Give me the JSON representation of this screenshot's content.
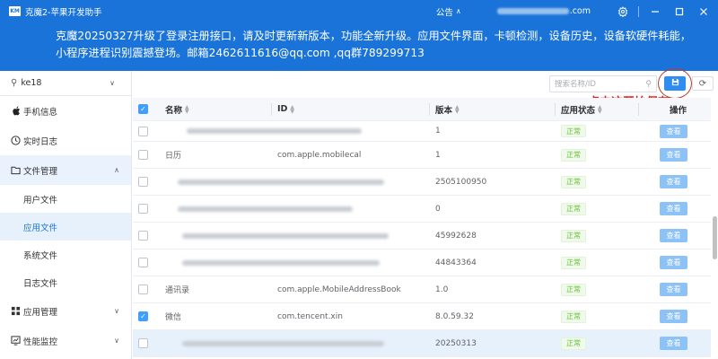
{
  "window": {
    "logo_text": "KM",
    "title": "克魔2-苹果开发助手",
    "notice_label": "公告",
    "account_domain": ".com",
    "icons": [
      "settings-icon",
      "minimize-icon",
      "maximize-icon",
      "close-icon"
    ]
  },
  "banner": {
    "text": "克魔20250327升级了登录注册接口，请及时更新新版本，功能全新升级。应用文件界面，卡顿检测，设备历史，设备软硬件耗能，小程序进程识别震撼登场。邮箱2462611616@qq.com ,qq群789299713"
  },
  "sidebar": {
    "device_name": "ke18",
    "items": [
      {
        "label": "手机信息",
        "icon": "apple-icon"
      },
      {
        "label": "实时日志",
        "icon": "log-icon"
      },
      {
        "label": "文件管理",
        "icon": "folder-icon",
        "expanded": true
      },
      {
        "label": "应用管理",
        "icon": "apps-icon"
      },
      {
        "label": "性能监控",
        "icon": "performance-icon"
      }
    ],
    "sub_items": [
      {
        "label": "用户文件"
      },
      {
        "label": "应用文件",
        "active": true
      },
      {
        "label": "系统文件"
      },
      {
        "label": "日志文件"
      }
    ]
  },
  "toolbar": {
    "search_placeholder": "搜索名称/ID",
    "save_icon": "save-icon",
    "refresh_icon": "refresh-icon",
    "annotation": "点击这开始保存"
  },
  "table": {
    "columns": {
      "name": "名称",
      "id": "ID",
      "version": "版本",
      "status": "应用状态",
      "action": "操作"
    },
    "rows": [
      {
        "name": "",
        "id": "",
        "version": "1",
        "status": "正常",
        "action": "查看",
        "checked": false
      },
      {
        "name": "日历",
        "id": "com.apple.mobilecal",
        "version": "1",
        "status": "正常",
        "action": "查看",
        "checked": false
      },
      {
        "name": "",
        "id": "",
        "version": "2505100950",
        "status": "正常",
        "action": "查看",
        "checked": false
      },
      {
        "name": "",
        "id": "",
        "version": "0",
        "status": "正常",
        "action": "查看",
        "checked": false
      },
      {
        "name": "",
        "id": "",
        "version": "45992628",
        "status": "正常",
        "action": "查看",
        "checked": false
      },
      {
        "name": "",
        "id": "",
        "version": "44843364",
        "status": "正常",
        "action": "查看",
        "checked": false
      },
      {
        "name": "通讯录",
        "id": "com.apple.MobileAddressBook",
        "version": "1.0",
        "status": "正常",
        "action": "查看",
        "checked": false
      },
      {
        "name": "微信",
        "id": "com.tencent.xin",
        "version": "8.0.59.32",
        "status": "正常",
        "action": "查看",
        "checked": true
      },
      {
        "name": "",
        "id": "",
        "version": "20250313",
        "status": "正常",
        "action": "查看",
        "checked": false,
        "highlighted": true
      }
    ]
  },
  "colors": {
    "brand": "#1a73d9",
    "annotation": "#e02020",
    "status_ok": "#67c23a",
    "view_button": "#8cc2f5"
  }
}
